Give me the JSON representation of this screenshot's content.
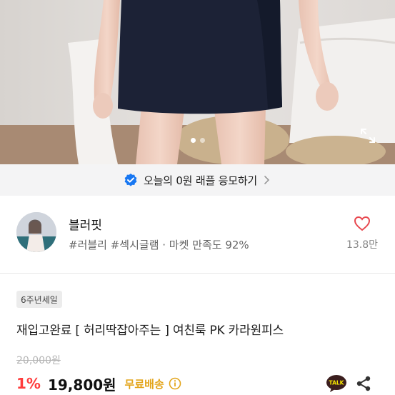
{
  "raffle_banner": {
    "text": "오늘의 0원 래플 응모하기"
  },
  "seller": {
    "name": "블러핏",
    "tags": "#러블리 #섹시글램 · 마켓 만족도 92%",
    "likes": "13.8만"
  },
  "product": {
    "badge": "6주년세일",
    "title": "재입고완료 [ 허리딱잡아주는 ] 여친룩 PK 카라원피스",
    "original_price": "20,000원",
    "discount": "1%",
    "price": "19,800원",
    "shipping": "무료배송"
  },
  "talk_icon_label": "TALK",
  "icons": [
    "expand-icon",
    "verified-check-icon",
    "chevron-right-icon",
    "heart-icon",
    "info-icon",
    "kakaotalk-icon",
    "share-icon"
  ],
  "colors": {
    "discount": "#ff3d3d",
    "shipping": "#e3a51b",
    "verified": "#1877f2",
    "heart": "#e8484f",
    "talk_bubble": "#3b1e1e"
  }
}
